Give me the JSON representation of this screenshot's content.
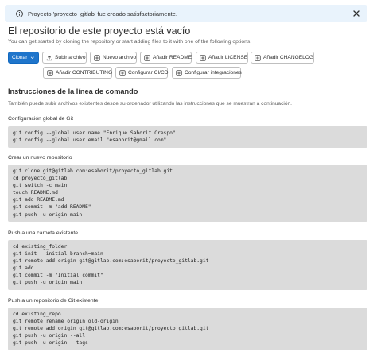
{
  "alert": {
    "message": "Proyecto 'proyecto_gitlab' fue creado satisfactoriamente."
  },
  "header": {
    "title": "El repositorio de este proyecto está vacío",
    "subtitle": "You can get started by cloning the repository or start adding files to it with one of the following options."
  },
  "buttons": {
    "clone": "Clonar",
    "upload": "Subir archivo",
    "new_file": "Nuevo archivo",
    "add_readme": "Añadir README",
    "add_license": "Añadir LICENSE",
    "add_changelog": "Añadir CHANGELOG",
    "add_contributing": "Añadir CONTRIBUTING",
    "configure_cicd": "Configurar CI/CD",
    "configure_integrations": "Configurar integraciones"
  },
  "instructions": {
    "title": "Instrucciones de la línea de comando",
    "description": "También puede subir archivos existentes desde su ordenador utilizando las instrucciones que se muestran a continuación."
  },
  "blocks": [
    {
      "title": "Configuración global de Git",
      "lines": [
        "git config --global user.name \"Enrique Saborit Crespo\"",
        "git config --global user.email \"esaborit@gmail.com\""
      ]
    },
    {
      "title": "Crear un nuevo repositorio",
      "lines": [
        "git clone git@gitlab.com:esaborit/proyecto_gitlab.git",
        "cd proyecto_gitlab",
        "git switch -c main",
        "touch README.md",
        "git add README.md",
        "git commit -m \"add README\"",
        "git push -u origin main"
      ]
    },
    {
      "title": "Push a una carpeta existente",
      "lines": [
        "cd existing_folder",
        "git init --initial-branch=main",
        "git remote add origin git@gitlab.com:esaborit/proyecto_gitlab.git",
        "git add .",
        "git commit -m \"Initial commit\"",
        "git push -u origin main"
      ]
    },
    {
      "title": "Push a un repositorio de Git existente",
      "lines": [
        "cd existing_repo",
        "git remote rename origin old-origin",
        "git remote add origin git@gitlab.com:esaborit/proyecto_gitlab.git",
        "git push -u origin --all",
        "git push -u origin --tags"
      ]
    }
  ],
  "colors": {
    "alert_bg": "#e9f3fc",
    "primary": "#1f75cb",
    "code_bg": "#dbdbdb"
  },
  "icons": {
    "alert": "info-icon",
    "close": "close-icon",
    "upload": "upload-icon",
    "plus": "plus-square-icon",
    "dropdown": "chevron-down-icon"
  }
}
